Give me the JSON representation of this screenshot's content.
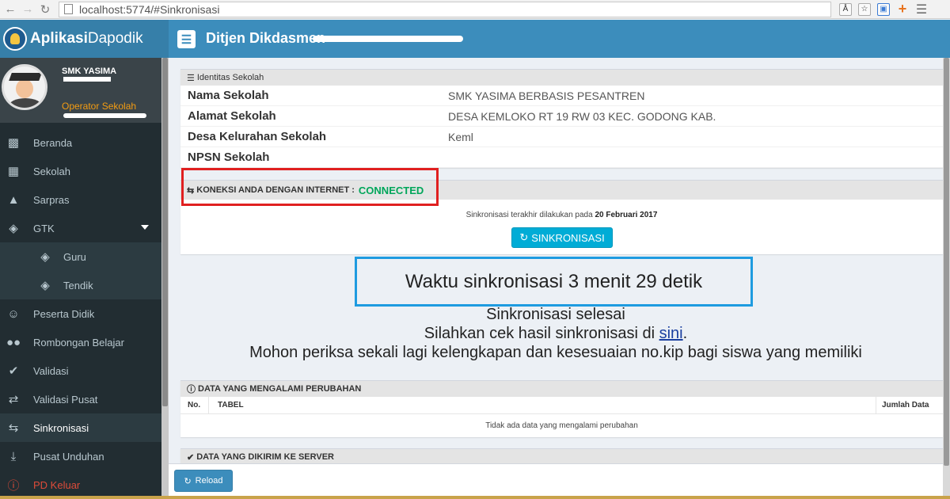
{
  "browser": {
    "url": "localhost:5774/#Sinkronisasi"
  },
  "header": {
    "brand_bold": "Aplikasi",
    "brand_rest": "Dapodik",
    "title": "Ditjen Dikdasmen"
  },
  "user": {
    "name": "SMK YASIMA",
    "role": "Operator Sekolah"
  },
  "sidebar": {
    "items": [
      {
        "label": "Beranda",
        "icon": "desktop-icon"
      },
      {
        "label": "Sekolah",
        "icon": "building-icon"
      },
      {
        "label": "Sarpras",
        "icon": "road-icon"
      },
      {
        "label": "GTK",
        "icon": "graduation-cap-icon"
      },
      {
        "label": "Guru",
        "icon": "graduation-cap-icon"
      },
      {
        "label": "Tendik",
        "icon": "graduation-cap-icon"
      },
      {
        "label": "Peserta Didik",
        "icon": "smile-icon"
      },
      {
        "label": "Rombongan Belajar",
        "icon": "users-icon"
      },
      {
        "label": "Validasi",
        "icon": "check-icon"
      },
      {
        "label": "Validasi Pusat",
        "icon": "retweet-icon"
      },
      {
        "label": "Sinkronisasi",
        "icon": "exchange-icon"
      },
      {
        "label": "Pusat Unduhan",
        "icon": "download-icon"
      },
      {
        "label": "PD Keluar",
        "icon": "info-circle-icon"
      }
    ]
  },
  "identity": {
    "header": "Identitas Sekolah",
    "rows": [
      {
        "label": "Nama Sekolah",
        "value": "SMK YASIMA BERBASIS PESANTREN"
      },
      {
        "label": "Alamat Sekolah",
        "value": "DESA KEMLOKO RT 19 RW 03 KEC. GODONG KAB."
      },
      {
        "label": "Desa Kelurahan Sekolah",
        "value": "Keml"
      },
      {
        "label": "NPSN Sekolah",
        "value": ""
      }
    ]
  },
  "connection": {
    "label": "KONEKSI ANDA DENGAN INTERNET :",
    "status": "CONNECTED",
    "last_sync_text": "Sinkronisasi terakhir dilakukan pada",
    "last_sync_date": "20 Februari 2017",
    "sync_button": "SINKRONISASI"
  },
  "sync_time": "Waktu sinkronisasi 3 menit 29 detik",
  "messages": {
    "done": "Sinkronisasi selesai",
    "check_prefix": "Silahkan cek hasil sinkronisasi di",
    "check_link": "sini",
    "check_suffix": ".",
    "kip": "Mohon periksa sekali lagi kelengkapan dan kesesuaian no.kip bagi siswa yang memiliki"
  },
  "changes": {
    "header": "DATA YANG MENGALAMI PERUBAHAN",
    "columns": [
      "No.",
      "TABEL",
      "Jumlah Data"
    ],
    "empty": "Tidak ada data yang mengalami perubahan"
  },
  "sent": {
    "header": "DATA YANG DIKIRIM KE SERVER"
  },
  "footer": {
    "reload": "Reload"
  }
}
